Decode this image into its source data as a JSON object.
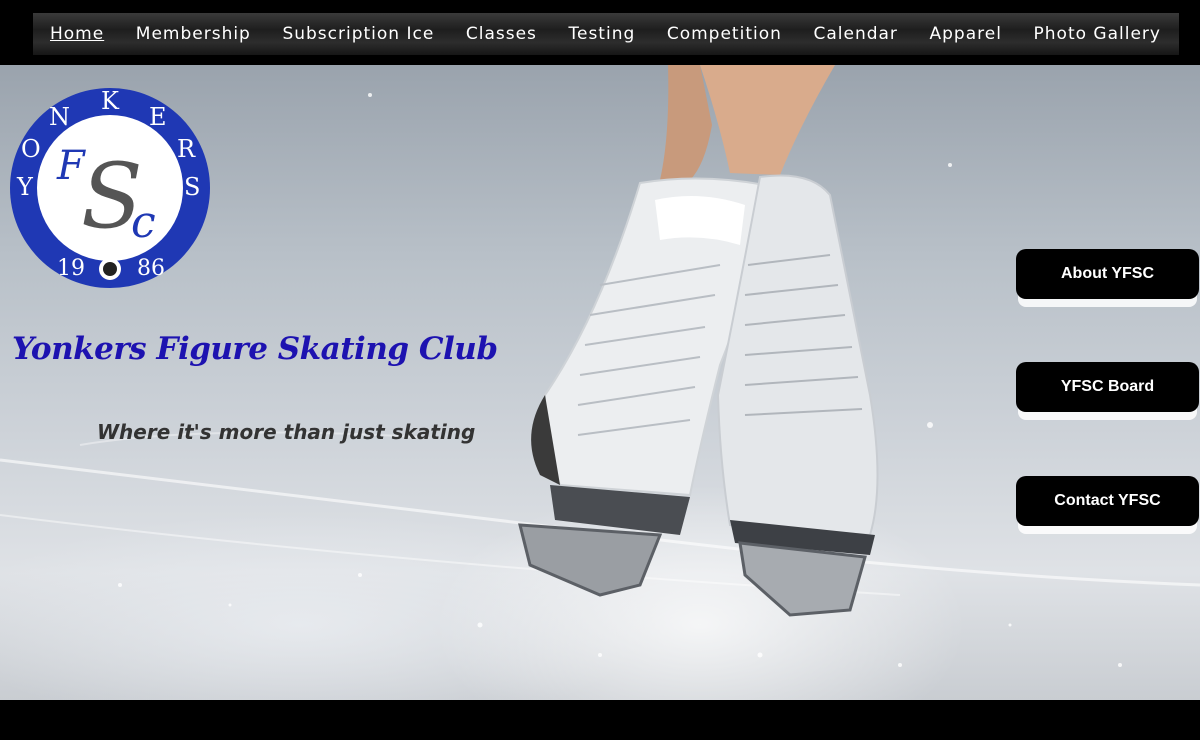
{
  "nav": {
    "items": [
      {
        "label": "Home",
        "active": true
      },
      {
        "label": "Membership"
      },
      {
        "label": "Subscription Ice"
      },
      {
        "label": "Classes"
      },
      {
        "label": "Testing"
      },
      {
        "label": "Competition"
      },
      {
        "label": "Calendar"
      },
      {
        "label": "Apparel"
      },
      {
        "label": "Photo Gallery"
      }
    ]
  },
  "logo": {
    "ring_text_top": "YONKERS",
    "monogram": "FSC",
    "year_left": "19",
    "year_right": "86",
    "ring_color": "#1f38b4"
  },
  "hero": {
    "title": "Yonkers Figure Skating Club",
    "tagline": "Where it's more than just skating",
    "title_color": "#1d12b0"
  },
  "side_buttons": {
    "about": "About YFSC",
    "board": "YFSC Board",
    "contact": "Contact YFSC"
  }
}
